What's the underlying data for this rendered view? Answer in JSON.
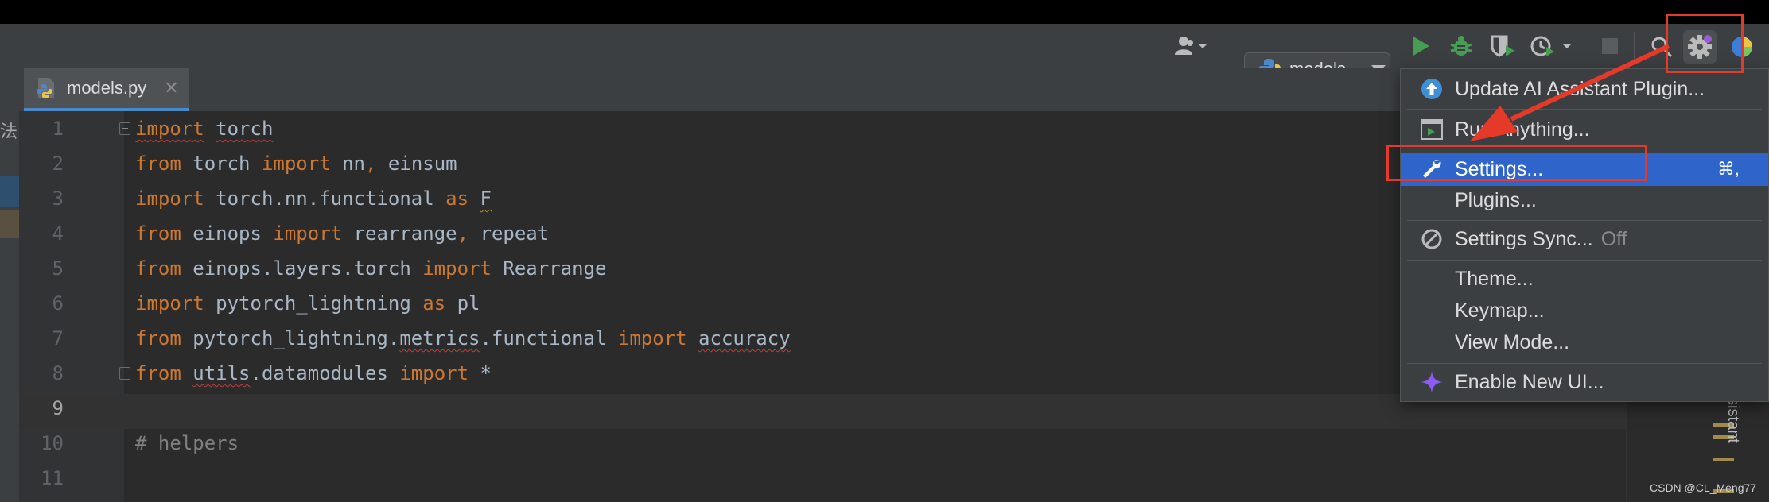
{
  "toolbar": {
    "run_config_label": "models",
    "icons": [
      "user-icon",
      "python-icon",
      "run-icon",
      "debug-icon",
      "coverage-icon",
      "profile-icon",
      "stop-icon",
      "search-icon",
      "gear-icon",
      "browser-icon"
    ]
  },
  "tabs": [
    {
      "label": "models.py",
      "icon": "python-file-icon"
    }
  ],
  "left_strip": {
    "char": "法"
  },
  "editor": {
    "current_line": 9,
    "lines": [
      {
        "n": "1",
        "tokens": [
          {
            "t": "import",
            "c": "kw",
            "w": "wv"
          },
          {
            "t": " "
          },
          {
            "t": "torch",
            "w": "wv"
          }
        ]
      },
      {
        "n": "2",
        "tokens": [
          {
            "t": "from",
            "c": "kw"
          },
          {
            "t": " torch "
          },
          {
            "t": "import",
            "c": "kw"
          },
          {
            "t": " nn"
          },
          {
            "t": ",",
            "c": "kw"
          },
          {
            "t": " einsum"
          }
        ]
      },
      {
        "n": "3",
        "tokens": [
          {
            "t": "import",
            "c": "kw"
          },
          {
            "t": " torch.nn.functional "
          },
          {
            "t": "as",
            "c": "kw"
          },
          {
            "t": " "
          },
          {
            "t": "F",
            "w": "wvy"
          }
        ]
      },
      {
        "n": "4",
        "tokens": [
          {
            "t": "from",
            "c": "kw"
          },
          {
            "t": " einops "
          },
          {
            "t": "import",
            "c": "kw"
          },
          {
            "t": " rearrange"
          },
          {
            "t": ",",
            "c": "kw"
          },
          {
            "t": " repeat"
          }
        ]
      },
      {
        "n": "5",
        "tokens": [
          {
            "t": "from",
            "c": "kw"
          },
          {
            "t": " einops.layers.torch "
          },
          {
            "t": "import",
            "c": "kw"
          },
          {
            "t": " Rearrange"
          }
        ]
      },
      {
        "n": "6",
        "tokens": [
          {
            "t": "import",
            "c": "kw"
          },
          {
            "t": " pytorch_lightning "
          },
          {
            "t": "as",
            "c": "kw"
          },
          {
            "t": " pl"
          }
        ]
      },
      {
        "n": "7",
        "tokens": [
          {
            "t": "from",
            "c": "kw"
          },
          {
            "t": " pytorch_lightning."
          },
          {
            "t": "metrics",
            "w": "wv"
          },
          {
            "t": ".functional "
          },
          {
            "t": "import",
            "c": "kw"
          },
          {
            "t": " "
          },
          {
            "t": "accuracy",
            "w": "wv"
          }
        ]
      },
      {
        "n": "8",
        "tokens": [
          {
            "t": "from",
            "c": "kw"
          },
          {
            "t": " "
          },
          {
            "t": "utils",
            "w": "wv"
          },
          {
            "t": ".datamodules "
          },
          {
            "t": "import",
            "c": "kw"
          },
          {
            "t": " *"
          }
        ]
      },
      {
        "n": "9",
        "tokens": []
      },
      {
        "n": "10",
        "tokens": [
          {
            "t": "# helpers",
            "c": "cm"
          }
        ]
      },
      {
        "n": "11",
        "tokens": []
      }
    ]
  },
  "menu": {
    "items": [
      {
        "label": "Update AI Assistant Plugin...",
        "icon": "update-arrow-icon"
      },
      {
        "label": "Run Anything...",
        "icon": "run-anything-icon"
      },
      {
        "label": "Settings...",
        "icon": "wrench-icon",
        "shortcut": "⌘,",
        "selected": true
      },
      {
        "label": "Plugins...",
        "icon": ""
      },
      {
        "label": "Settings Sync...",
        "icon": "sync-disabled-icon",
        "suffix": "Off"
      },
      {
        "label": "Theme...",
        "icon": ""
      },
      {
        "label": "Keymap...",
        "icon": ""
      },
      {
        "label": "View Mode...",
        "icon": ""
      },
      {
        "label": "Enable New UI...",
        "icon": "sparkle-icon"
      }
    ]
  },
  "side_panel": {
    "label": "sistant"
  },
  "watermark": "CSDN @CL_Meng77",
  "colors": {
    "accent": "#2f65ca",
    "annotation": "#e53a2a",
    "keyword": "#cc7832",
    "comment": "#808080"
  }
}
